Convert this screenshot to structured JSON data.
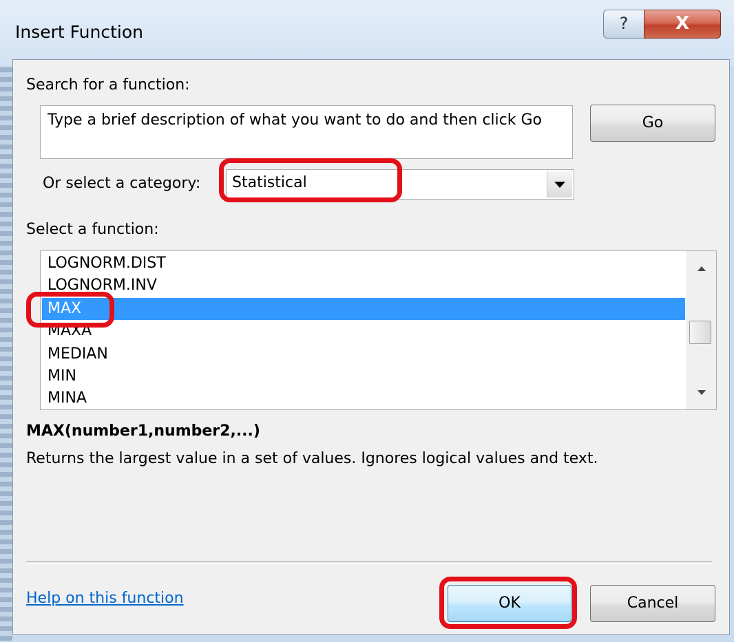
{
  "window": {
    "title": "Insert Function",
    "help_button": "?",
    "close_button": "X"
  },
  "search": {
    "label": "Search for a function:",
    "placeholder": "Type a brief description of what you want to do and then click Go",
    "go_label": "Go"
  },
  "category": {
    "label": "Or select a category:",
    "selected": "Statistical"
  },
  "functions": {
    "label": "Select a function:",
    "items": [
      "LOGNORM.DIST",
      "LOGNORM.INV",
      "MAX",
      "MAXA",
      "MEDIAN",
      "MIN",
      "MINA"
    ],
    "selected": "MAX"
  },
  "details": {
    "syntax": "MAX(number1,number2,...)",
    "description": "Returns the largest value in a set of values. Ignores logical values and text."
  },
  "footer": {
    "help_link": "Help on this function",
    "ok_label": "OK",
    "cancel_label": "Cancel"
  },
  "colors": {
    "annotation_red": "#e3101a",
    "selection_blue": "#3399ff",
    "link_blue": "#0066cc"
  }
}
